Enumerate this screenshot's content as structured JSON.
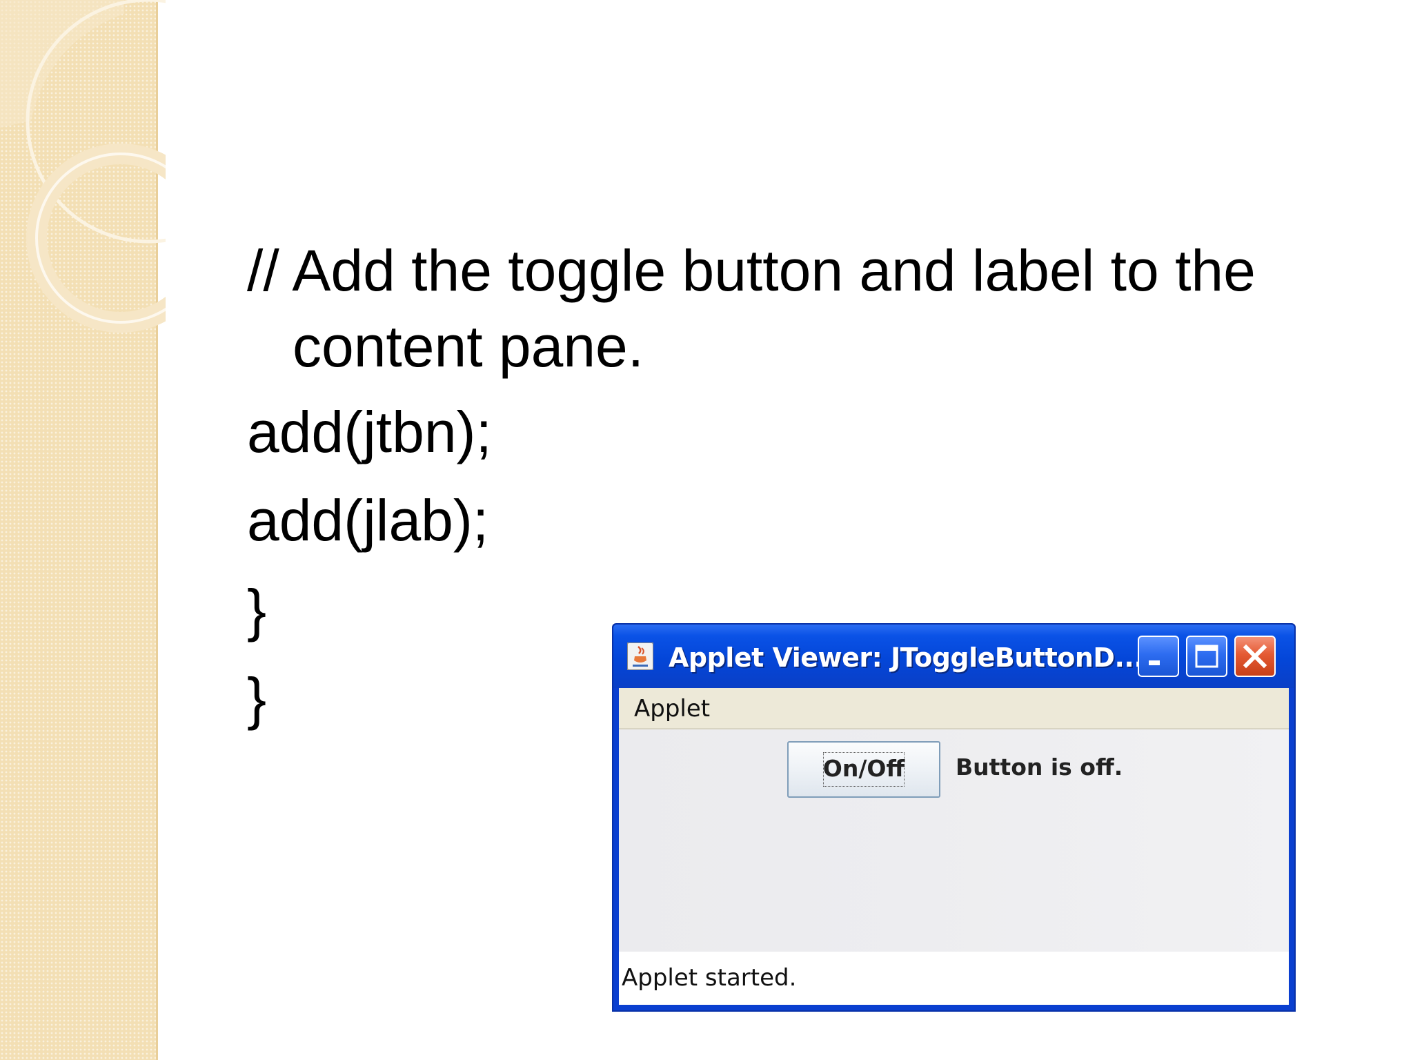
{
  "slide": {
    "lines": [
      "// Add the toggle button and label to the",
      "content pane.",
      "add(jtbn);",
      "add(jlab);",
      "}",
      "}"
    ]
  },
  "applet_window": {
    "title": "Applet Viewer: JToggleButtonD...",
    "app_icon": "java-cup-icon",
    "controls": {
      "minimize_icon": "minimize-icon",
      "maximize_icon": "maximize-icon",
      "close_icon": "close-icon"
    },
    "menu": {
      "items": [
        "Applet"
      ]
    },
    "toggle_button": {
      "label": "On/Off",
      "pressed": false
    },
    "state_label": "Button is off.",
    "status": "Applet started."
  },
  "colors": {
    "side_band": "#f3dfb4",
    "titlebar": "#0446d8",
    "close_button": "#e45a33",
    "menubar": "#ede9d8",
    "content": "#ececec"
  }
}
